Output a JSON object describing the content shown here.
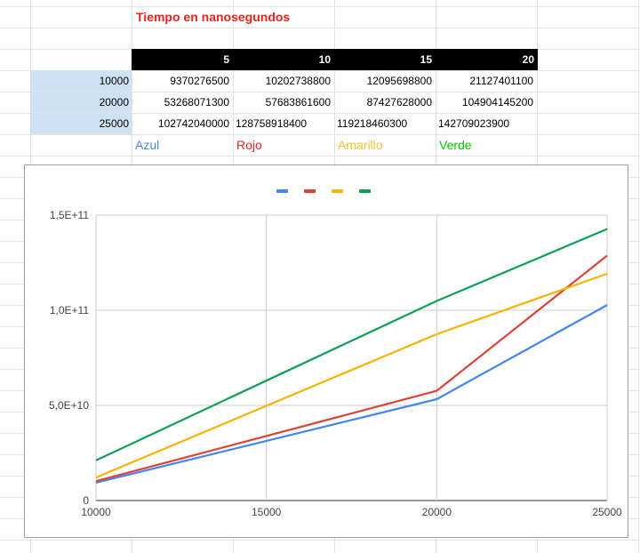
{
  "sheet": {
    "title": "Tiempo en nanosegundos",
    "headers": [
      "5",
      "10",
      "15",
      "20"
    ],
    "rows": [
      {
        "label": "10000",
        "values": [
          "9370276500",
          "10202738800",
          "12095698800",
          "21127401100"
        ]
      },
      {
        "label": "20000",
        "values": [
          "53268071300",
          "57683861600",
          "87427628000",
          "104904145200"
        ]
      },
      {
        "label": "25000",
        "values": [
          "102742040000",
          "128758918400",
          "119218460300",
          "142709023900"
        ]
      }
    ],
    "color_labels": [
      {
        "text": "Azul",
        "color": "#4a86e8"
      },
      {
        "text": "Rojo",
        "color": "#e8241c"
      },
      {
        "text": "Amarillo",
        "color": "#f1c232"
      },
      {
        "text": "Verde",
        "color": "#00c800"
      }
    ]
  },
  "chart_data": {
    "type": "line",
    "x": [
      10000,
      20000,
      25000
    ],
    "series": [
      {
        "color": "#4285f4",
        "values": [
          9370276500,
          53268071300,
          102742040000
        ]
      },
      {
        "color": "#db4437",
        "values": [
          10202738800,
          57683861600,
          128758918400
        ]
      },
      {
        "color": "#f4b400",
        "values": [
          12095698800,
          87427628000,
          119218460300
        ]
      },
      {
        "color": "#0f9d58",
        "values": [
          21127401100,
          104904145200,
          142709023900
        ]
      }
    ],
    "xlim": [
      10000,
      25000
    ],
    "ylim": [
      0,
      150000000000
    ],
    "x_ticks": [
      10000,
      15000,
      20000,
      25000
    ],
    "x_tick_labels": [
      "10000",
      "15000",
      "20000",
      "25000"
    ],
    "y_ticks": [
      0,
      50000000000,
      100000000000,
      150000000000
    ],
    "y_tick_labels": [
      "0",
      "5,0E+10",
      "1,0E+11",
      "1,5E+11"
    ],
    "legend": "top",
    "grid": true
  }
}
